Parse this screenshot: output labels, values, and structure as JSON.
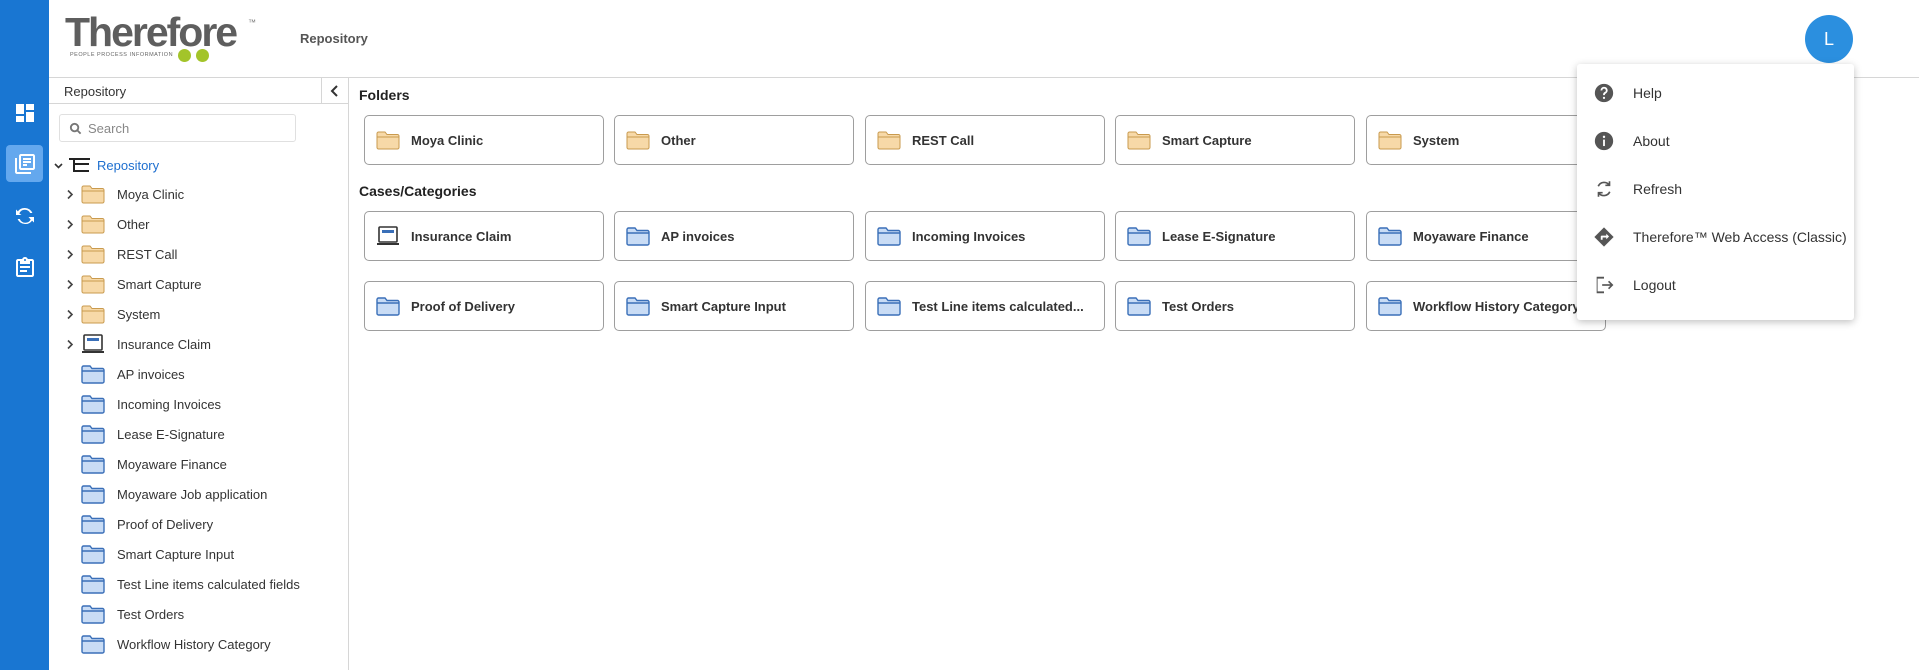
{
  "header": {
    "logo_text": "Therefore",
    "logo_tm": "™",
    "logo_tagline": "PEOPLE  PROCESS  INFORMATION",
    "breadcrumb": "Repository",
    "avatar_initial": "L",
    "avatar_color": "#2b8fdf"
  },
  "rail": {
    "color": "#1976d2",
    "items": [
      {
        "icon": "dashboard-icon",
        "active": false
      },
      {
        "icon": "repository-icon",
        "active": true
      },
      {
        "icon": "workflow-icon",
        "active": false
      },
      {
        "icon": "tasks-clipboard-icon",
        "active": false
      }
    ]
  },
  "tree": {
    "title": "Repository",
    "search_placeholder": "Search",
    "root_label": "Repository",
    "items": [
      {
        "label": "Moya Clinic",
        "type": "folder",
        "expandable": true
      },
      {
        "label": "Other",
        "type": "folder",
        "expandable": true
      },
      {
        "label": "REST Call",
        "type": "folder",
        "expandable": true
      },
      {
        "label": "Smart Capture",
        "type": "folder",
        "expandable": true
      },
      {
        "label": "System",
        "type": "folder",
        "expandable": true
      },
      {
        "label": "Insurance Claim",
        "type": "case",
        "expandable": true
      },
      {
        "label": "AP invoices",
        "type": "category",
        "expandable": false
      },
      {
        "label": "Incoming Invoices",
        "type": "category",
        "expandable": false
      },
      {
        "label": "Lease E-Signature",
        "type": "category",
        "expandable": false
      },
      {
        "label": "Moyaware Finance",
        "type": "category",
        "expandable": false
      },
      {
        "label": "Moyaware Job application",
        "type": "category",
        "expandable": false
      },
      {
        "label": "Proof of Delivery",
        "type": "category",
        "expandable": false
      },
      {
        "label": "Smart Capture Input",
        "type": "category",
        "expandable": false
      },
      {
        "label": "Test Line items calculated fields",
        "type": "category",
        "expandable": false
      },
      {
        "label": "Test Orders",
        "type": "category",
        "expandable": false
      },
      {
        "label": "Workflow History Category",
        "type": "category",
        "expandable": false
      }
    ]
  },
  "main": {
    "folders_title": "Folders",
    "folders": [
      {
        "label": "Moya Clinic"
      },
      {
        "label": "Other"
      },
      {
        "label": "REST Call"
      },
      {
        "label": "Smart Capture"
      },
      {
        "label": "System"
      }
    ],
    "cases_title": "Cases/Categories",
    "cases": [
      {
        "label": "Insurance Claim",
        "type": "case"
      },
      {
        "label": "AP invoices",
        "type": "category"
      },
      {
        "label": "Incoming Invoices",
        "type": "category"
      },
      {
        "label": "Lease E-Signature",
        "type": "category"
      },
      {
        "label": "Moyaware Finance",
        "type": "category"
      },
      {
        "label": "Proof of Delivery",
        "type": "category"
      },
      {
        "label": "Smart Capture Input",
        "type": "category"
      },
      {
        "label": "Test Line items calculated...",
        "type": "category"
      },
      {
        "label": "Test Orders",
        "type": "category"
      },
      {
        "label": "Workflow History Category",
        "type": "category"
      }
    ]
  },
  "menu": {
    "items": [
      {
        "label": "Help",
        "icon": "help-icon"
      },
      {
        "label": "About",
        "icon": "info-icon"
      },
      {
        "label": "Refresh",
        "icon": "refresh-icon"
      },
      {
        "label": "Therefore™ Web Access (Classic)",
        "icon": "directions-icon"
      },
      {
        "label": "Logout",
        "icon": "logout-icon"
      }
    ]
  }
}
